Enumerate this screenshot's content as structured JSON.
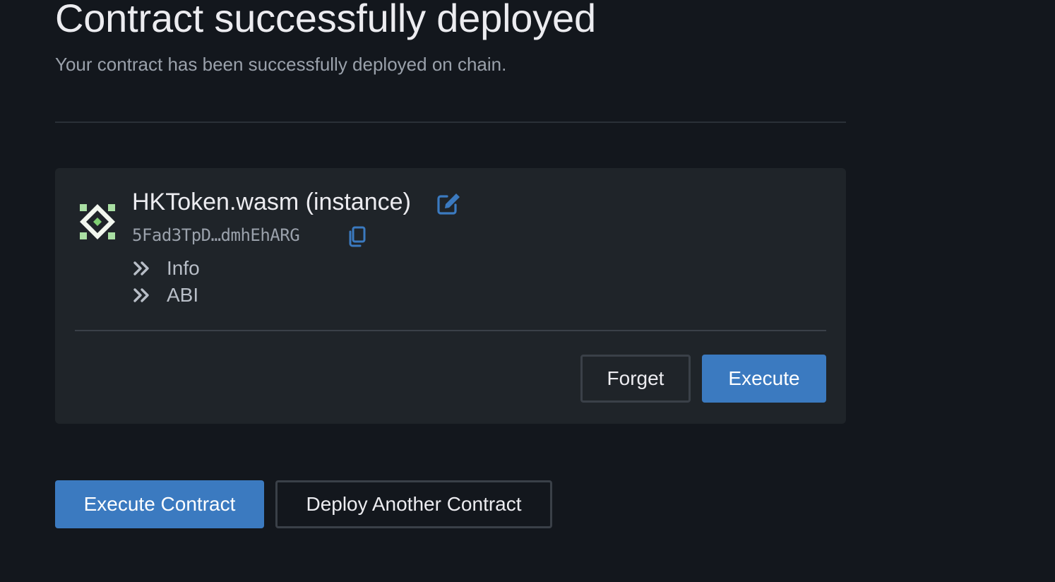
{
  "header": {
    "title": "Contract successfully deployed",
    "subtitle": "Your contract has been successfully deployed on chain."
  },
  "contract": {
    "name": "HKToken.wasm (instance)",
    "address": "5Fad3TpD…dmhEhARG",
    "details": [
      {
        "label": "Info",
        "icon": "double-chevron-right-icon"
      },
      {
        "label": "ABI",
        "icon": "double-chevron-right-icon"
      }
    ],
    "actions": {
      "forget_label": "Forget",
      "execute_label": "Execute"
    }
  },
  "footer_actions": {
    "execute_contract_label": "Execute Contract",
    "deploy_another_label": "Deploy Another Contract"
  },
  "colors": {
    "background": "#13171d",
    "card": "#1f2429",
    "accent": "#3b7ac0",
    "identicon": "#a9dfa3"
  }
}
